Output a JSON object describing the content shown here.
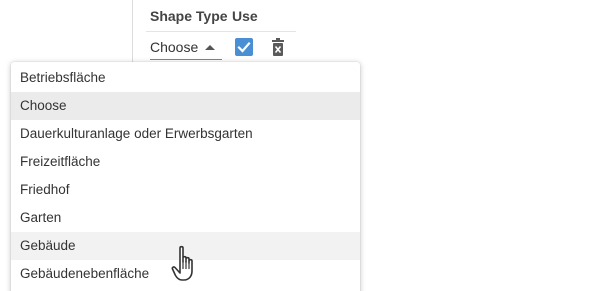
{
  "table": {
    "headers": {
      "shape_type": "Shape Type",
      "use": "Use"
    },
    "row": {
      "shape_type_value": "Choose",
      "use_checked": true
    }
  },
  "dropdown": {
    "options": [
      "Betriebsfläche",
      "Choose",
      "Dauerkulturanlage oder Erwerbsgarten",
      "Freizeitfläche",
      "Friedhof",
      "Garten",
      "Gebäude",
      "Gebäudenebenfläche"
    ],
    "selected": "Choose",
    "hovered": "Gebäude"
  },
  "colors": {
    "accent": "#4a8fd4",
    "selected_bg": "#ebebeb",
    "hover_bg": "#f2f2f2"
  },
  "icons": {
    "caret": "caret-up-icon",
    "checkbox": "checkbox-checked-icon",
    "delete": "trash-icon",
    "cursor": "hand-pointer-cursor"
  }
}
